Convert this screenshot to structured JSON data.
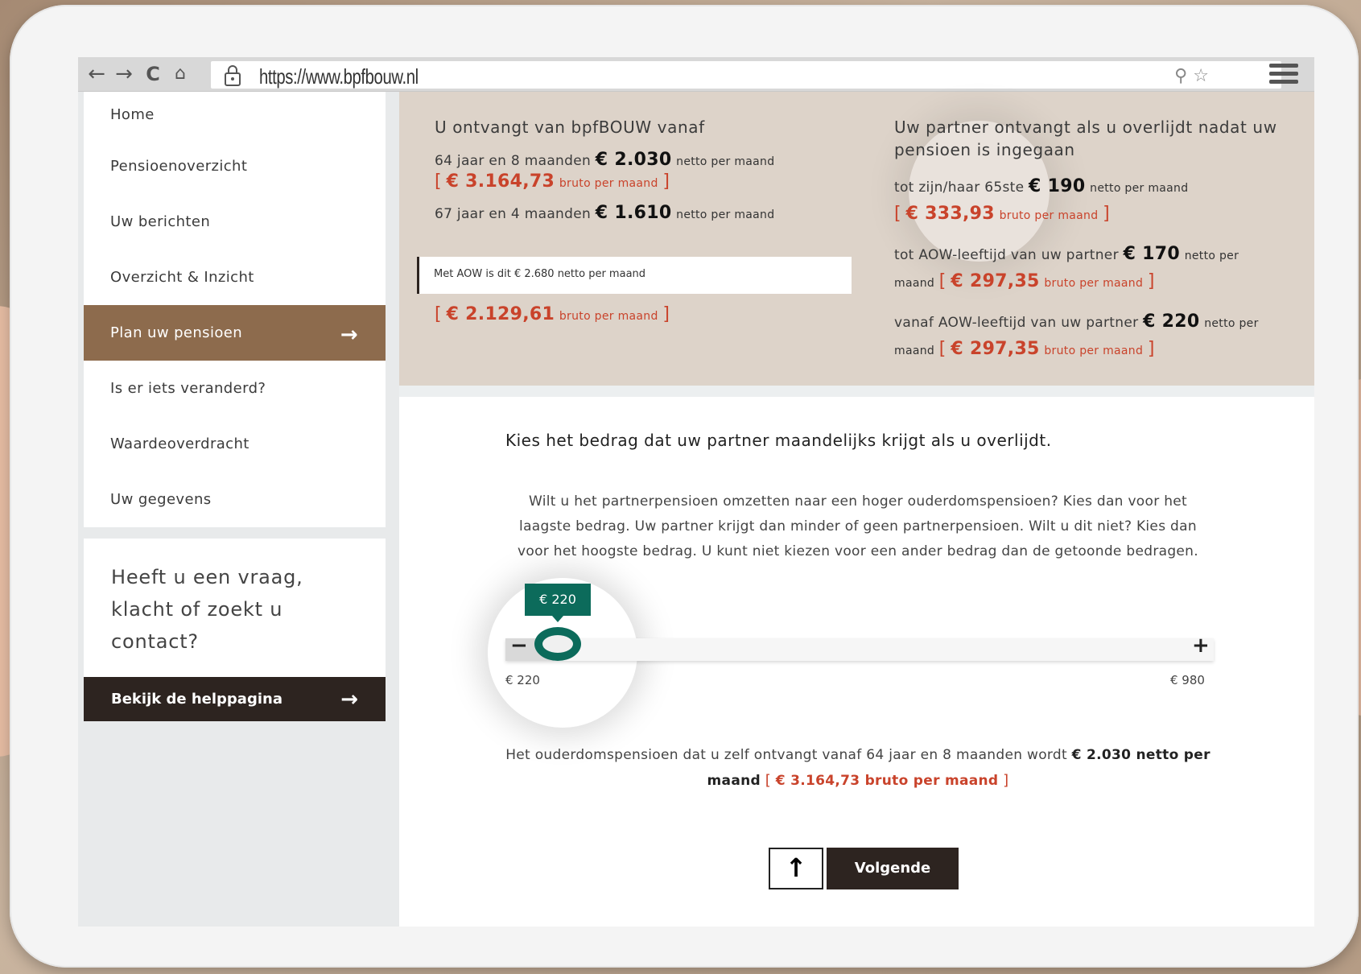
{
  "browser": {
    "url": "https://www.bpfbouw.nl"
  },
  "sidebar": {
    "items": [
      {
        "label": "Home"
      },
      {
        "label": "Pensioenoverzicht"
      },
      {
        "label": "Uw berichten"
      },
      {
        "label": "Overzicht & Inzicht"
      },
      {
        "label": "Plan uw pensioen"
      },
      {
        "label": "Is er iets veranderd?"
      },
      {
        "label": "Waardeoverdracht"
      },
      {
        "label": "Uw gegevens"
      }
    ],
    "help_question": "Heeft u een vraag, klacht of zoekt u contact?",
    "help_button": "Bekijk de helppagina"
  },
  "summary": {
    "left_title": "U ontvangt van bpfBOUW vanaf",
    "row1_age": "64 jaar en 8 maanden",
    "row1_netto": "€ 2.030",
    "row1_netto_suffix": "netto per maand",
    "row1_bruto": "€ 3.164,73",
    "row1_bruto_suffix": "bruto per maand",
    "row2_age": "67 jaar en 4 maanden",
    "row2_netto": "€ 1.610",
    "row2_netto_suffix": "netto per maand",
    "aow_text": "Met AOW is dit  € 2.680 netto per maand",
    "row2_bruto": "€ 2.129,61",
    "row2_bruto_suffix": "bruto per maand",
    "right_title": "Uw partner ontvangt als u overlijdt nadat uw pensioen is ingegaan",
    "r1_label": "tot zijn/haar 65ste",
    "r1_netto": "€ 190",
    "r1_netto_suffix": "netto per maand",
    "r1_bruto": "€ 333,93",
    "r1_bruto_suffix": "bruto per maand",
    "r2_label": "tot AOW-leeftijd van uw partner",
    "r2_netto": "€ 170",
    "r2_netto_suffix_a": "netto per",
    "r2_netto_suffix_b": "maand",
    "r2_bruto": "€ 297,35",
    "r2_bruto_suffix": "bruto per maand",
    "r3_label": "vanaf AOW-leeftijd van uw partner",
    "r3_netto": "€ 220",
    "r3_netto_suffix_a": "netto per",
    "r3_netto_suffix_b": "maand",
    "r3_bruto": "€ 297,35",
    "r3_bruto_suffix": "bruto per maand"
  },
  "choose": {
    "title": "Kies het bedrag dat uw partner maandelijks krijgt als u overlijdt.",
    "text": "Wilt u het partnerpensioen omzetten naar een hoger ouderdomspensioen? Kies dan voor het laagste bedrag. Uw partner krijgt dan minder of geen partnerpensioen. Wilt u dit niet? Kies dan voor het hoogste bedrag. U kunt niet kiezen voor een ander bedrag dan de getoonde bedragen.",
    "slider_value": "€ 220",
    "slider_min": "€ 220",
    "slider_max": "€ 980",
    "minus": "−",
    "plus": "+",
    "result_pre": "Het ouderdomspensioen dat u zelf ontvangt vanaf 64 jaar en 8 maanden wordt",
    "result_netto": "€ 2.030 netto per maand",
    "result_bruto": "€ 3.164,73 bruto per maand",
    "next_label": "Volgende"
  },
  "colors": {
    "active_nav": "#8d6b4d",
    "dark": "#2d2420",
    "accent_red": "#c9432b",
    "slider_green": "#0c6b5b",
    "summary_bg": "#ddd3c9"
  }
}
